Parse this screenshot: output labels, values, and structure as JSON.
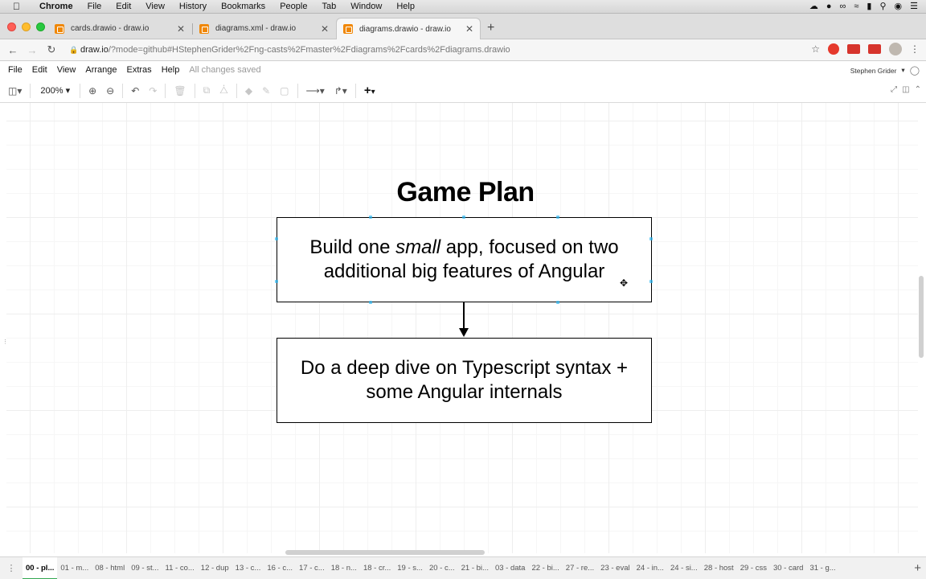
{
  "mac_menubar": {
    "app": "Chrome",
    "items": [
      "File",
      "Edit",
      "View",
      "History",
      "Bookmarks",
      "People",
      "Tab",
      "Window",
      "Help"
    ]
  },
  "tabs": [
    {
      "title": "cards.drawio - draw.io",
      "icon": "drawio-icon",
      "active": false
    },
    {
      "title": "diagrams.xml - draw.io",
      "icon": "drawio-icon",
      "active": false
    },
    {
      "title": "diagrams.drawio - draw.io",
      "icon": "drawio-icon",
      "active": true
    }
  ],
  "address": {
    "host": "draw.io",
    "rest": "/?mode=github#HStephenGrider%2Fng-casts%2Fmaster%2Fdiagrams%2Fcards%2Fdiagrams.drawio"
  },
  "drawio_menu": {
    "items": [
      "File",
      "Edit",
      "View",
      "Arrange",
      "Extras",
      "Help"
    ],
    "status": "All changes saved",
    "user": "Stephen Grider"
  },
  "toolbar": {
    "zoom": "200%"
  },
  "diagram": {
    "title": "Game Plan",
    "box1_before": "Build one ",
    "box1_em": "small",
    "box1_after": " app, focused on two additional big features of Angular",
    "box2": "Do a deep dive on Typescript syntax + some Angular internals"
  },
  "pages": [
    "00 - pl...",
    "01 - m...",
    "08 - html",
    "09 - st...",
    "11 - co...",
    "12 - dup",
    "13 - c...",
    "16 - c...",
    "17 - c...",
    "18 - n...",
    "18 - cr...",
    "19 - s...",
    "20 - c...",
    "21 - bi...",
    "03 - data",
    "22 - bi...",
    "27 - re...",
    "23 - eval",
    "24 - in...",
    "24 - si...",
    "28 - host",
    "29 - css",
    "30 - card",
    "31 - g..."
  ],
  "active_page_index": 0
}
